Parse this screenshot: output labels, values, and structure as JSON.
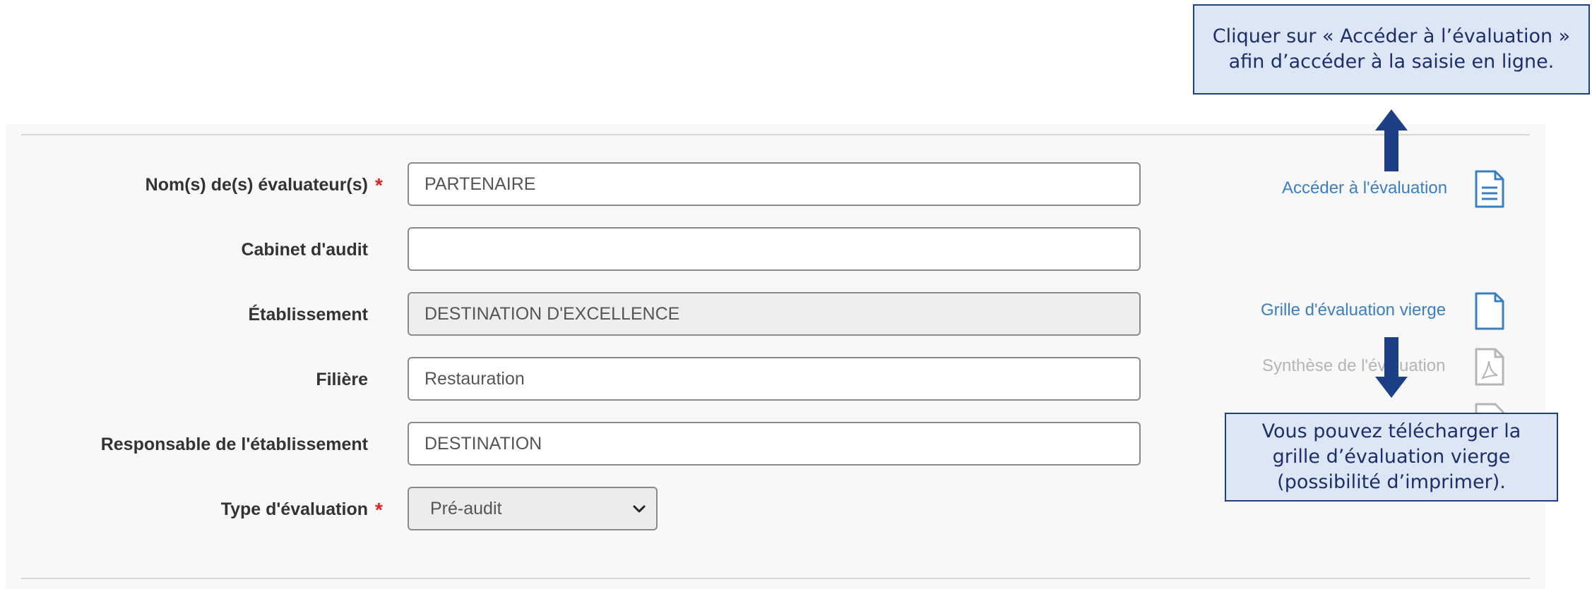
{
  "form": {
    "evaluators_label": "Nom(s) de(s) évaluateur(s)",
    "evaluators_value": "PARTENAIRE",
    "firm_label": "Cabinet d'audit",
    "firm_value": "",
    "establishment_label": "Établissement",
    "establishment_value": "DESTINATION D'EXCELLENCE",
    "sector_label": "Filière",
    "sector_value": "Restauration",
    "manager_label": "Responsable de l'établissement",
    "manager_value": "DESTINATION",
    "eval_type_label": "Type d'évaluation",
    "eval_type_selected": "Pré-audit",
    "required_marker": "*"
  },
  "actions": {
    "access_evaluation": "Accéder à l'évaluation",
    "blank_grid": "Grille d'évaluation vierge",
    "evaluation_summary": "Synthèse de l'évaluation"
  },
  "callouts": {
    "top": "Cliquer sur « Accéder à l’évaluation » afin d’accéder à la saisie en ligne.",
    "bottom": "Vous pouvez télécharger la grille d’évaluation vierge (possibilité d’imprimer)."
  },
  "colors": {
    "link": "#3a7fc1",
    "callout_bg": "#dce6f4",
    "callout_border": "#1d3f86",
    "arrow": "#1d3f86",
    "required": "#e02424"
  },
  "icons": {
    "access": "document-lines-icon",
    "blank_grid": "blank-document-icon",
    "summary": "pdf-document-icon"
  }
}
